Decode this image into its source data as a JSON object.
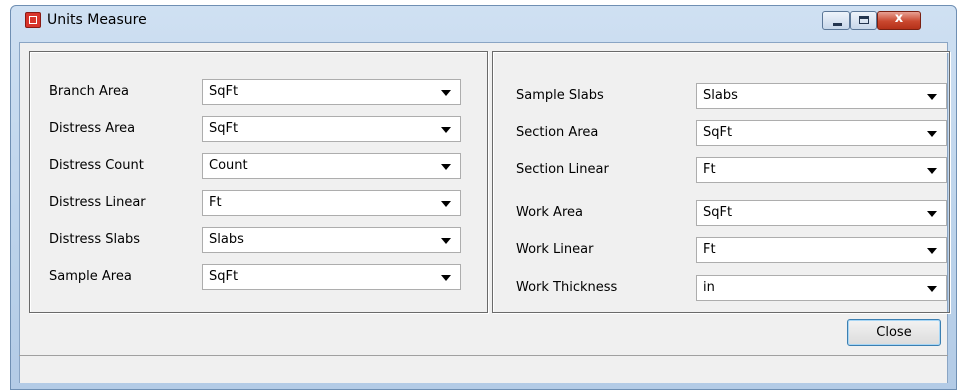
{
  "window": {
    "title": "Units Measure",
    "icon": "app-icon"
  },
  "left_group": [
    {
      "label": "Branch Area",
      "value": "SqFt"
    },
    {
      "label": "Distress Area",
      "value": "SqFt"
    },
    {
      "label": "Distress Count",
      "value": "Count"
    },
    {
      "label": "Distress Linear",
      "value": "Ft"
    },
    {
      "label": "Distress Slabs",
      "value": "Slabs"
    },
    {
      "label": "Sample Area",
      "value": "SqFt"
    }
  ],
  "right_group": [
    {
      "label": "Sample Slabs",
      "value": "Slabs"
    },
    {
      "label": "Section Area",
      "value": "SqFt"
    },
    {
      "label": "Section Linear",
      "value": "Ft"
    },
    {
      "label": "Work Area",
      "value": "SqFt"
    },
    {
      "label": "Work Linear",
      "value": "Ft"
    },
    {
      "label": "Work Thickness",
      "value": "in"
    }
  ],
  "buttons": {
    "close_label": "Close",
    "close_glyph": "x"
  },
  "colors": {
    "title_bar": "#bcd3eb",
    "close_button_red": "#c9472e",
    "dialog_bg": "#f0f0f0"
  }
}
